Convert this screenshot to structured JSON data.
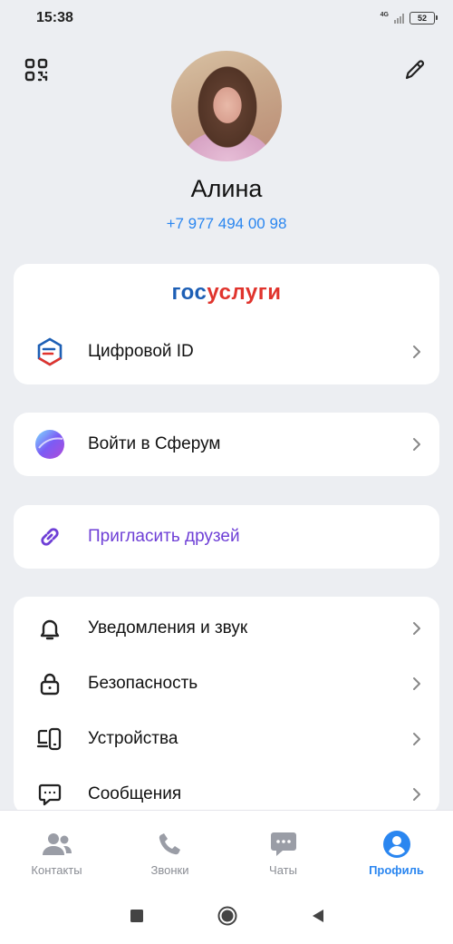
{
  "status_bar": {
    "time": "15:38",
    "network": "4G",
    "battery": "52"
  },
  "header": {
    "qr_icon": "qr-code-icon",
    "edit_icon": "pencil-icon"
  },
  "profile": {
    "name": "Алина",
    "phone": "+7 977 494 00 98"
  },
  "gosuslugi": {
    "logo_part1": "гос",
    "logo_part2": "услуги",
    "digital_id_label": "Цифровой ID"
  },
  "sferum": {
    "label": "Войти в Сферум"
  },
  "invite": {
    "label": "Пригласить друзей"
  },
  "settings": {
    "items": [
      {
        "label": "Уведомления и звук",
        "icon": "bell-icon"
      },
      {
        "label": "Безопасность",
        "icon": "lock-icon"
      },
      {
        "label": "Устройства",
        "icon": "devices-icon"
      },
      {
        "label": "Сообщения",
        "icon": "message-icon"
      }
    ]
  },
  "bottom_nav": {
    "items": [
      {
        "label": "Контакты",
        "icon": "contacts-icon"
      },
      {
        "label": "Звонки",
        "icon": "phone-icon"
      },
      {
        "label": "Чаты",
        "icon": "chat-icon"
      },
      {
        "label": "Профиль",
        "icon": "profile-icon"
      }
    ],
    "active": "Профиль"
  },
  "colors": {
    "accent": "#2a86f0",
    "invite": "#6e3fd6",
    "background": "#eceef2"
  }
}
